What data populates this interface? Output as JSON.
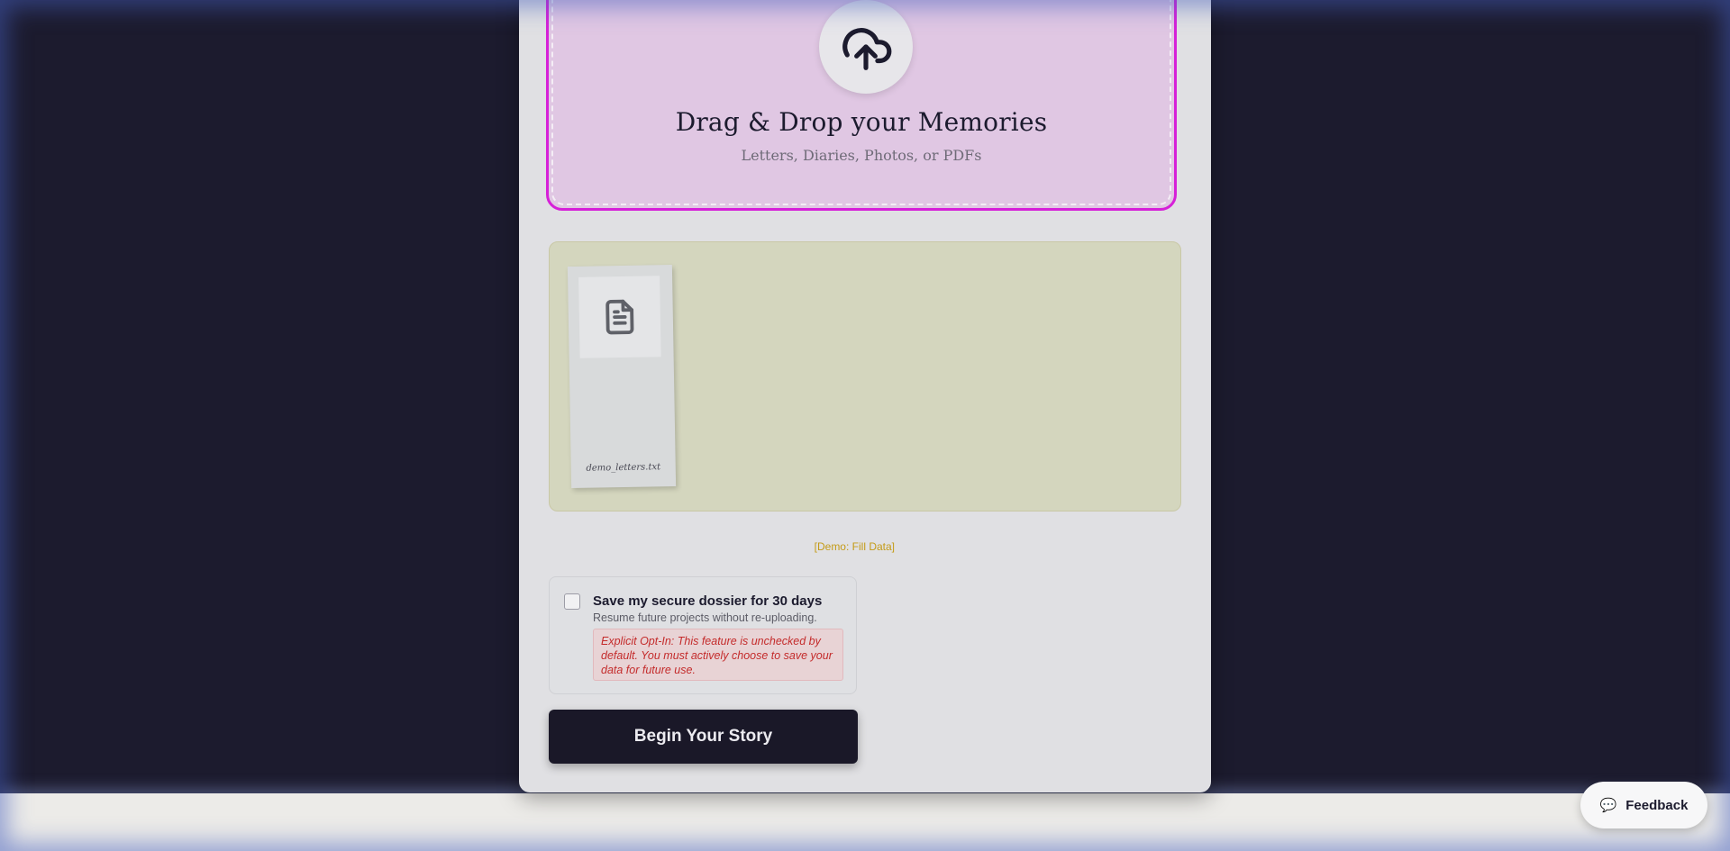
{
  "dropzone": {
    "title": "Drag & Drop your Memories",
    "subtitle": "Letters, Diaries, Photos, or PDFs",
    "icon": "cloud-upload-icon",
    "accent_color": "#d620d8"
  },
  "files": {
    "items": [
      {
        "name": "demo_letters.txt",
        "icon": "document-icon"
      }
    ]
  },
  "demo_link": "[Demo: Fill Data]",
  "save_option": {
    "checked": false,
    "title": "Save my secure dossier for 30 days",
    "description": "Resume future projects without re-uploading.",
    "warning": "Explicit Opt-In: This feature is unchecked by default. You must actively choose to save your data for future use."
  },
  "primary_action": {
    "label": "Begin Your Story"
  },
  "feedback": {
    "label": "Feedback",
    "icon": "speech-bubble-icon"
  },
  "colors": {
    "background": "#1c1b2e",
    "card": "#e0e0e3",
    "button": "#1a1828",
    "warning_text": "#c42b2b"
  }
}
